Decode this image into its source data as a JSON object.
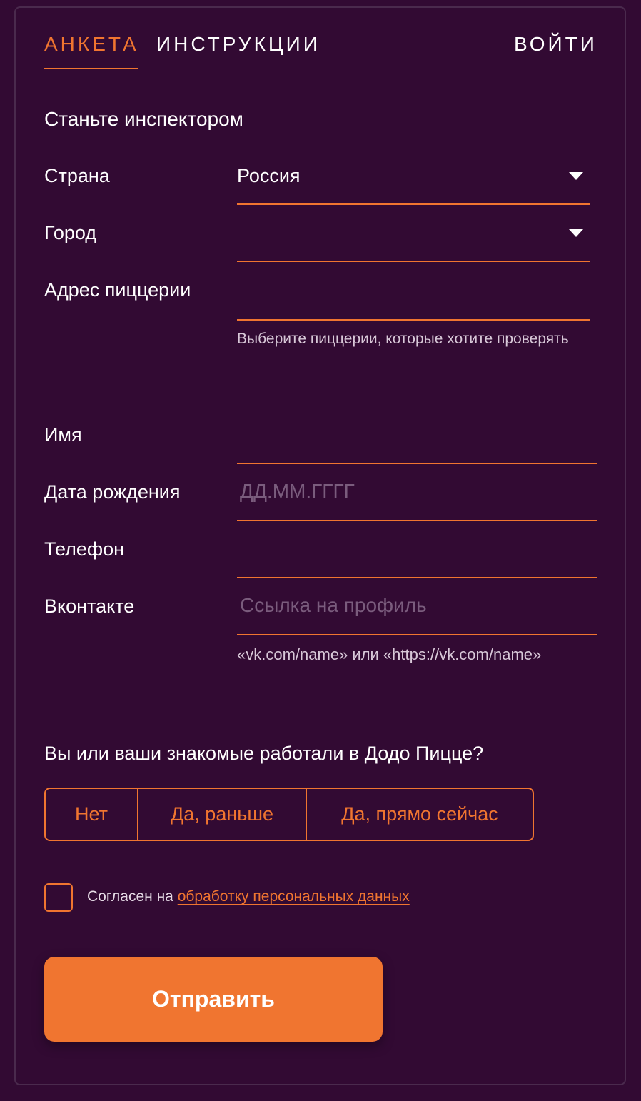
{
  "tabs": {
    "anketa": "Анкета",
    "instructions": "Инструкции",
    "login": "Войти"
  },
  "form": {
    "title": "Станьте инспектором",
    "country": {
      "label": "Страна",
      "value": "Россия"
    },
    "city": {
      "label": "Город",
      "value": ""
    },
    "address": {
      "label": "Адрес пиццерии",
      "hint": "Выберите пиццерии, которые хотите проверять"
    },
    "name": {
      "label": "Имя",
      "value": ""
    },
    "birthdate": {
      "label": "Дата рождения",
      "placeholder": "ДД.ММ.ГГГГ"
    },
    "phone": {
      "label": "Телефон",
      "value": ""
    },
    "vk": {
      "label": "Вконтакте",
      "placeholder": "Ссылка на профиль",
      "hint": "«vk.com/name» или «https://vk.com/name»"
    }
  },
  "question": {
    "text": "Вы или ваши знакомые работали в Додо Пицце?",
    "options": [
      "Нет",
      "Да, раньше",
      "Да, прямо сейчас"
    ]
  },
  "consent": {
    "prefix": "Согласен на ",
    "link": "обработку персональных данных",
    "checked": false
  },
  "submit_label": "Отправить",
  "colors": {
    "background": "#320a33",
    "accent": "#f07530",
    "placeholder": "#7a5c7d"
  }
}
